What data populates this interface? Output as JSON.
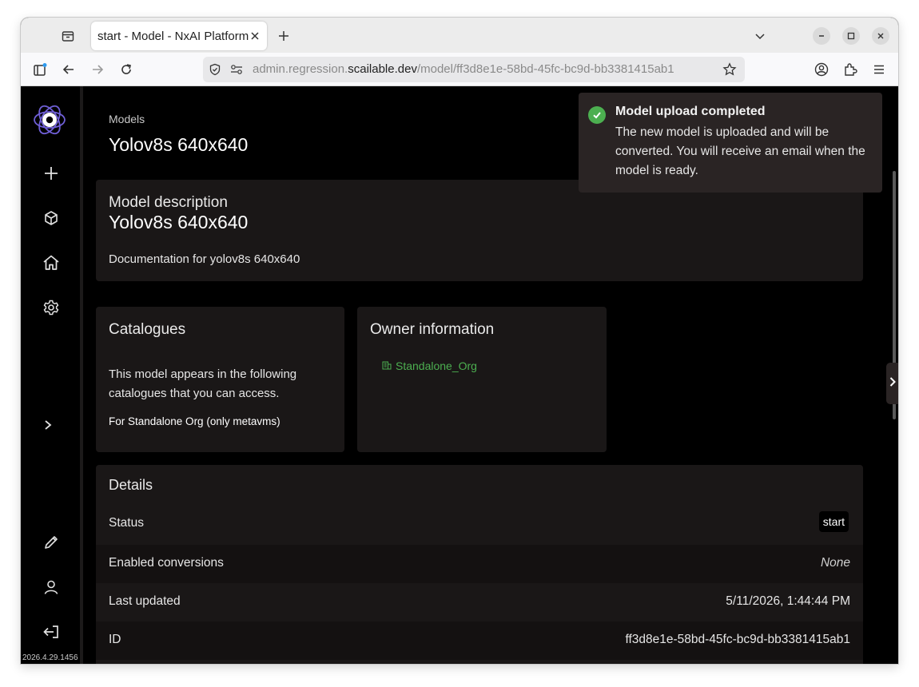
{
  "browser": {
    "tab_title": "start - Model - NxAI Platform",
    "url_scheme_text": "admin.regression.",
    "url_host": "scailable.dev",
    "url_path": "/model/ff3d8e1e-58bd-45fc-bc9d-bb3381415ab1"
  },
  "sidebar": {
    "version": "2026.4.29.1456",
    "icons": [
      "app-logo-icon",
      "plus-icon",
      "cube-icon",
      "home-icon",
      "gear-icon",
      "chevron-right-icon",
      "pencil-icon",
      "user-icon",
      "logout-icon"
    ]
  },
  "header": {
    "breadcrumb": "Models",
    "title": "Yolov8s 640x640"
  },
  "description_card": {
    "heading": "Model description",
    "title": "Yolov8s 640x640",
    "body": "Documentation for yolov8s 640x640"
  },
  "catalogues_card": {
    "heading": "Catalogues",
    "body": "This model appears in the following catalogues that you can access.",
    "item": "For Standalone Org (only metavms)"
  },
  "owner_card": {
    "heading": "Owner information",
    "org_name": "Standalone_Org"
  },
  "details_card": {
    "heading": "Details",
    "rows": [
      {
        "label": "Status",
        "value": "start"
      },
      {
        "label": "Enabled conversions",
        "value": "None"
      },
      {
        "label": "Last updated",
        "value": "5/11/2026, 1:44:44 PM"
      },
      {
        "label": "ID",
        "value": "ff3d8e1e-58bd-45fc-bc9d-bb3381415ab1"
      }
    ]
  },
  "toast": {
    "title": "Model upload completed",
    "body": "The new model is uploaded and will be converted. You will receive an email when the model is ready."
  },
  "colors": {
    "accent_green": "#4caf50",
    "card_bg": "#1a1717",
    "page_bg": "#000000",
    "logo_purple": "#6f5fd6"
  }
}
